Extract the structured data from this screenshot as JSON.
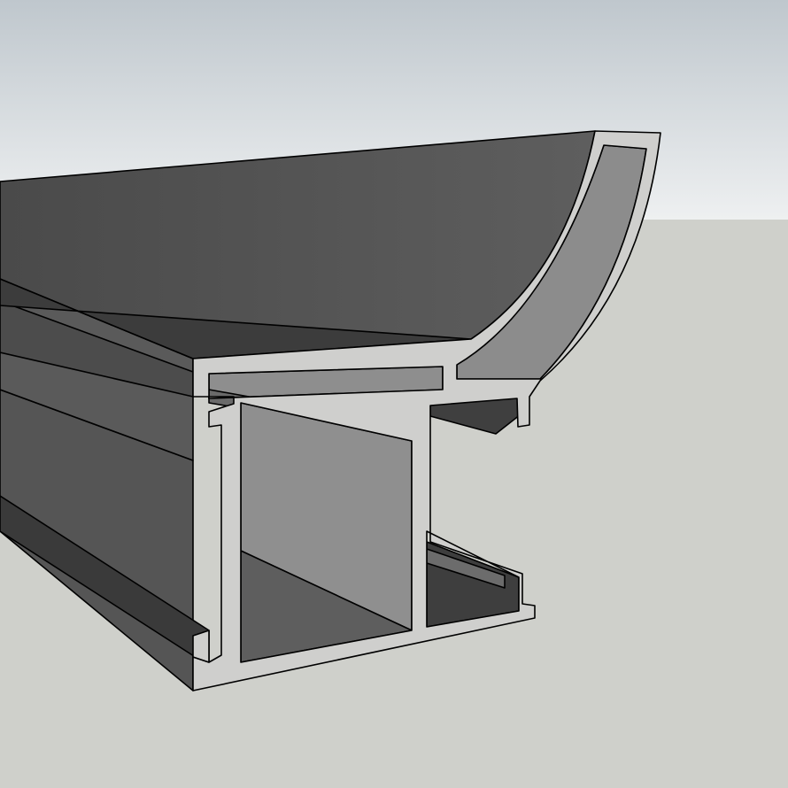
{
  "scene": {
    "subject": "aluminium-extrusion-profile",
    "colors": {
      "sky_top": "#bfc7cd",
      "sky_bottom": "#eef0f1",
      "ground": "#cfd0cb",
      "section_face": "#cfcfcd",
      "top_surface": "#555555",
      "dark_side": "#3e3e3e",
      "mid_side": "#5a5a5a",
      "cavity_light": "#8e8e8e",
      "cavity_dark": "#595959",
      "edge": "#000000"
    }
  }
}
